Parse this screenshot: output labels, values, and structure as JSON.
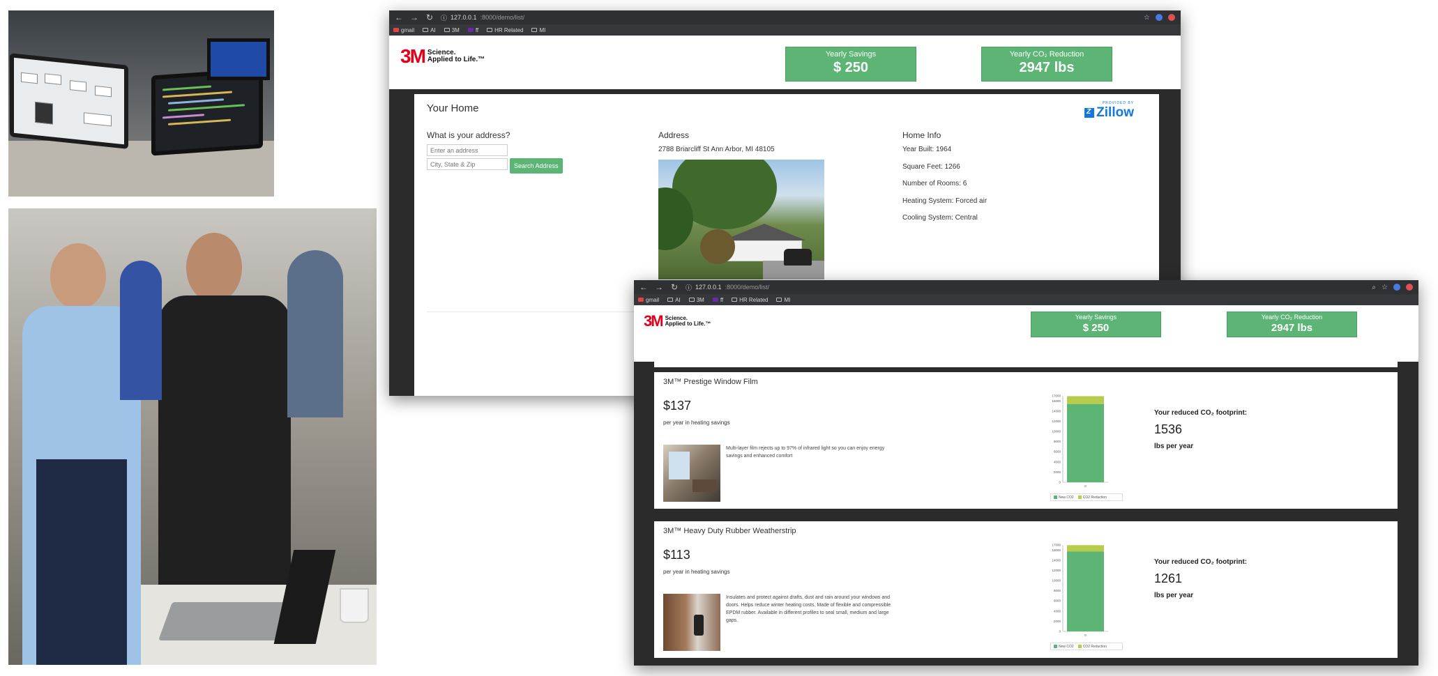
{
  "colors": {
    "accent_green": "#5cb574",
    "lime": "#b7cc4b",
    "brand_red": "#e3001b",
    "zillow_blue": "#1277e1"
  },
  "window1": {
    "url_host": "127.0.0.1",
    "url_path": ":8000/demo/list/",
    "bookmarks": [
      "gmail",
      "AI",
      "3M",
      "ff",
      "HR Related",
      "MI"
    ],
    "logo": {
      "mark": "3M",
      "tag_line1": "Science.",
      "tag_line2": "Applied to Life.™"
    },
    "savings": {
      "label": "Yearly Savings",
      "value": "$ 250"
    },
    "co2": {
      "label": "Yearly CO₂ Reduction",
      "value": "2947 lbs"
    },
    "section_title": "Your Home",
    "zillow": {
      "provided_by": "PROVIDED BY",
      "brand": "Zillow"
    },
    "address_question": "What is your address?",
    "address_placeholder": "Enter an address",
    "city_placeholder": "City, State & Zip",
    "search_button": "Search Address",
    "address_heading": "Address",
    "address_value": "2788 Briarcliff St Ann Arbor, MI 48105",
    "home_info_heading": "Home Info",
    "home_info": [
      "Year Built: 1964",
      "Square Feet: 1266",
      "Number of Rooms: 6",
      "Heating System: Forced air",
      "Cooling System: Central"
    ]
  },
  "window2": {
    "url_host": "127.0.0.1",
    "url_path": ":8000/demo/list/",
    "bookmarks": [
      "gmail",
      "AI",
      "3M",
      "ff",
      "HR Related",
      "MI"
    ],
    "logo": {
      "mark": "3M",
      "tag_line1": "Science.",
      "tag_line2": "Applied to Life.™"
    },
    "savings": {
      "label": "Yearly Savings",
      "value": "$ 250"
    },
    "co2": {
      "label": "Yearly CO₂ Reduction",
      "value": "2947 lbs"
    },
    "products": [
      {
        "title": "3M™ Prestige Window Film",
        "price": "$137",
        "per_year": "per year in heating savings",
        "description": "Multi-layer film rejects up to 97% of infrared light so you can enjoy energy savings and enhanced comfort",
        "footprint_label": "Your reduced CO₂ footprint:",
        "footprint_value": "1536",
        "footprint_unit": "lbs per year"
      },
      {
        "title": "3M™ Heavy Duty Rubber Weatherstrip",
        "price": "$113",
        "per_year": "per year in heating savings",
        "description": "Insulates and protect against drafts, dust and rain around your windows and doors. Helps reduce winter heating costs. Made of flexible and compressible EPDM rubber. Available in different profiles to seal small, medium and large gaps.",
        "footprint_label": "Your reduced CO₂ footprint:",
        "footprint_value": "1261",
        "footprint_unit": "lbs per year"
      }
    ]
  },
  "chart_data": [
    {
      "type": "bar",
      "stacked": true,
      "categories": [
        "0"
      ],
      "series": [
        {
          "name": "New CO2",
          "values": [
            15400
          ],
          "color": "#5cb574"
        },
        {
          "name": "CO2 Reduction",
          "values": [
            1536
          ],
          "color": "#b7cc4b"
        }
      ],
      "yticks": [
        0,
        2000,
        4000,
        6000,
        8000,
        10000,
        12000,
        14000,
        16000,
        17000
      ],
      "ylim": [
        0,
        17000
      ],
      "legend": "bottom"
    },
    {
      "type": "bar",
      "stacked": true,
      "categories": [
        "0"
      ],
      "series": [
        {
          "name": "New CO2",
          "values": [
            15700
          ],
          "color": "#5cb574"
        },
        {
          "name": "CO2 Reduction",
          "values": [
            1261
          ],
          "color": "#b7cc4b"
        }
      ],
      "yticks": [
        0,
        2000,
        4000,
        6000,
        8000,
        10000,
        12000,
        14000,
        16000,
        17000
      ],
      "ylim": [
        0,
        17000
      ],
      "legend": "bottom"
    }
  ]
}
